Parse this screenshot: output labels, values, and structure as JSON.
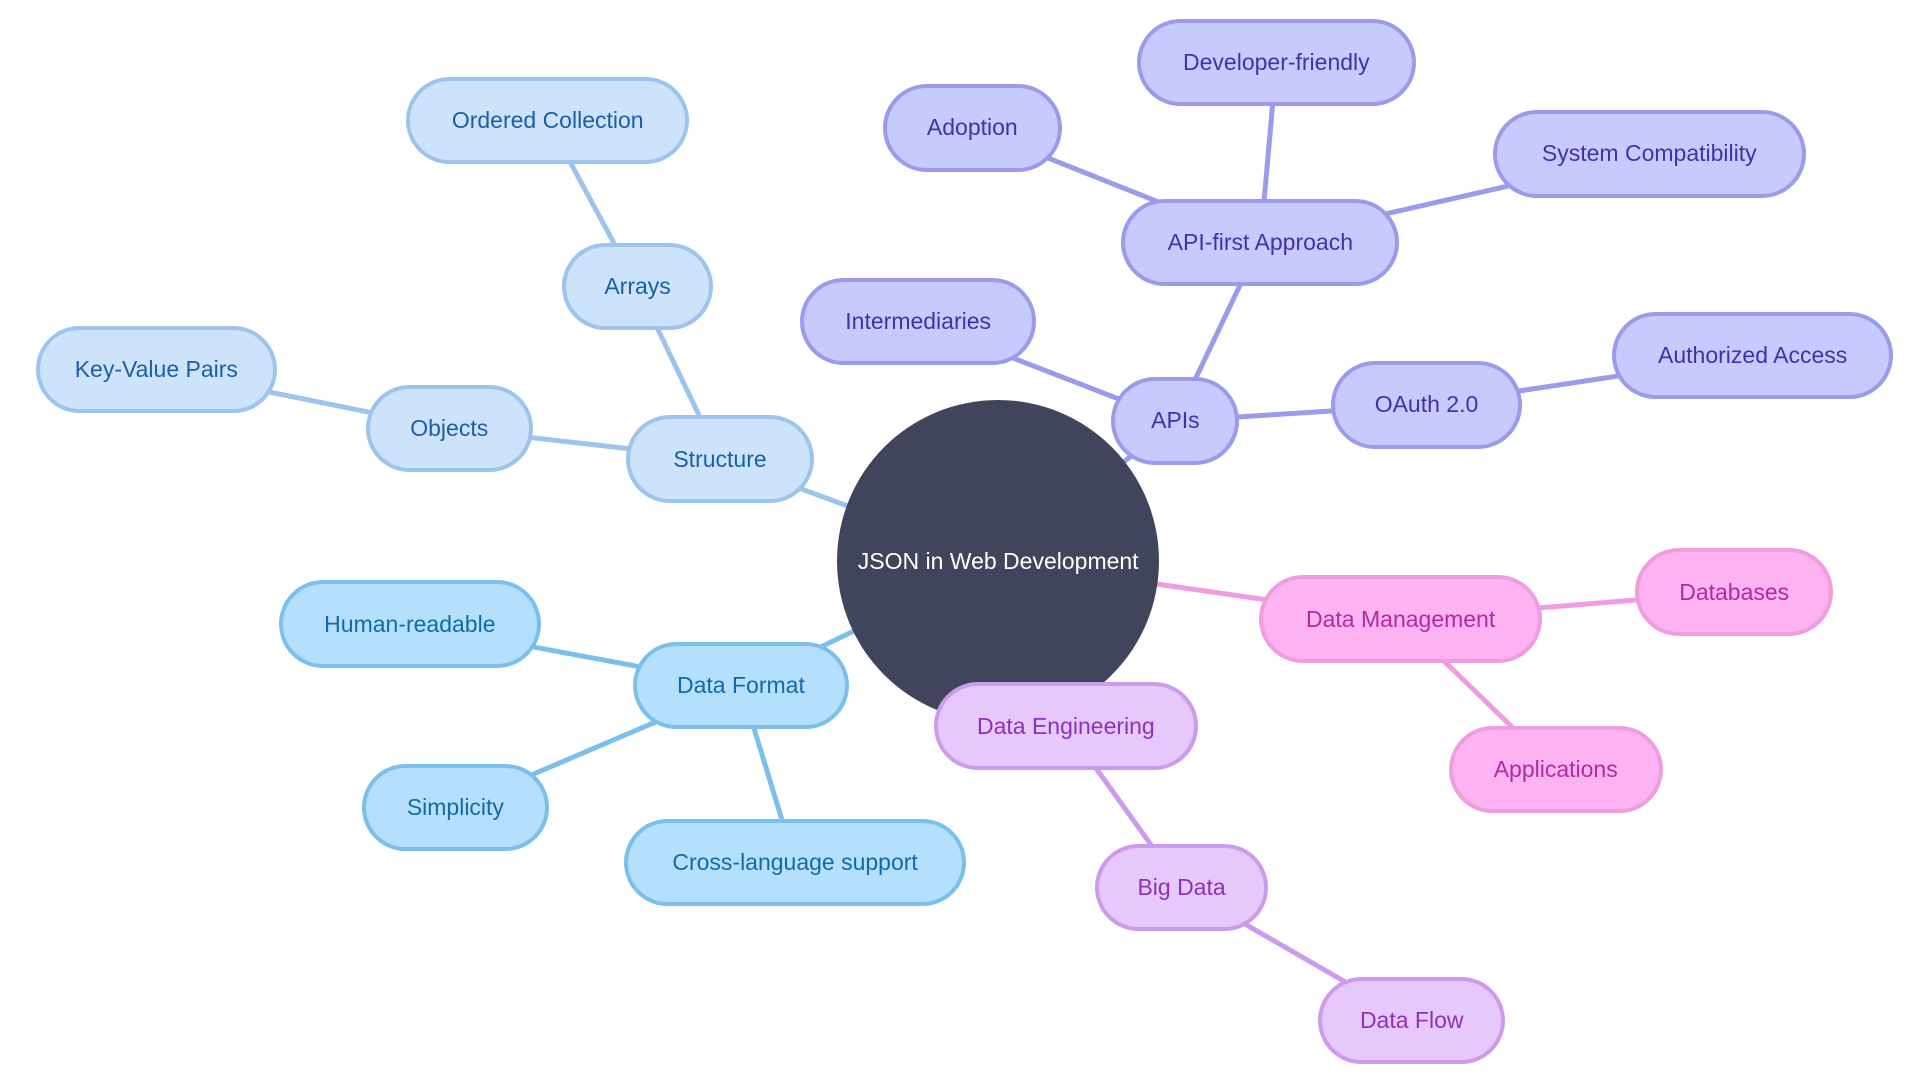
{
  "title": "JSON in Web Development",
  "colors": {
    "root_fill": "#41455b",
    "structure": {
      "fill": "#cde3fb",
      "stroke": "#9dc4ec",
      "text": "#1a5fa8"
    },
    "data_format": {
      "fill": "#b5e0fd",
      "stroke": "#7bbfec",
      "text": "#136aa8"
    },
    "apis": {
      "fill": "#c8c9fc",
      "stroke": "#9a9ceb",
      "text": "#3a36a8"
    },
    "data_management": {
      "fill": "#fdb2f1",
      "stroke": "#f09ce0",
      "text": "#b22aa0"
    },
    "data_engineering": {
      "fill": "#e7c8fc",
      "stroke": "#cd9bee",
      "text": "#8c32b8"
    }
  },
  "mindmap": {
    "root": {
      "id": "root",
      "label": "JSON in Web Development"
    },
    "nodes": [
      {
        "id": "structure",
        "label": "Structure",
        "parent": "root",
        "branch": "structure"
      },
      {
        "id": "objects",
        "label": "Objects",
        "parent": "structure",
        "branch": "structure"
      },
      {
        "id": "key-value-pairs",
        "label": "Key-Value Pairs",
        "parent": "objects",
        "branch": "structure"
      },
      {
        "id": "arrays",
        "label": "Arrays",
        "parent": "structure",
        "branch": "structure"
      },
      {
        "id": "ordered-collection",
        "label": "Ordered Collection",
        "parent": "arrays",
        "branch": "structure"
      },
      {
        "id": "data-format",
        "label": "Data Format",
        "parent": "root",
        "branch": "format"
      },
      {
        "id": "human-readable",
        "label": "Human-readable",
        "parent": "data-format",
        "branch": "format"
      },
      {
        "id": "simplicity",
        "label": "Simplicity",
        "parent": "data-format",
        "branch": "format"
      },
      {
        "id": "cross-language-support",
        "label": "Cross-language support",
        "parent": "data-format",
        "branch": "format"
      },
      {
        "id": "apis",
        "label": "APIs",
        "parent": "root",
        "branch": "apis"
      },
      {
        "id": "intermediaries",
        "label": "Intermediaries",
        "parent": "apis",
        "branch": "apis"
      },
      {
        "id": "api-first-approach",
        "label": "API-first Approach",
        "parent": "apis",
        "branch": "apis"
      },
      {
        "id": "adoption",
        "label": "Adoption",
        "parent": "api-first-approach",
        "branch": "apis"
      },
      {
        "id": "developer-friendly",
        "label": "Developer-friendly",
        "parent": "api-first-approach",
        "branch": "apis"
      },
      {
        "id": "system-compatibility",
        "label": "System Compatibility",
        "parent": "api-first-approach",
        "branch": "apis"
      },
      {
        "id": "oauth-2-0",
        "label": "OAuth 2.0",
        "parent": "apis",
        "branch": "apis"
      },
      {
        "id": "authorized-access",
        "label": "Authorized Access",
        "parent": "oauth-2-0",
        "branch": "apis"
      },
      {
        "id": "data-management",
        "label": "Data Management",
        "parent": "root",
        "branch": "mgmt"
      },
      {
        "id": "databases",
        "label": "Databases",
        "parent": "data-management",
        "branch": "mgmt"
      },
      {
        "id": "applications",
        "label": "Applications",
        "parent": "data-management",
        "branch": "mgmt"
      },
      {
        "id": "data-engineering",
        "label": "Data Engineering",
        "parent": "root",
        "branch": "eng"
      },
      {
        "id": "big-data",
        "label": "Big Data",
        "parent": "data-engineering",
        "branch": "eng"
      },
      {
        "id": "data-flow",
        "label": "Data Flow",
        "parent": "big-data",
        "branch": "eng"
      }
    ]
  }
}
